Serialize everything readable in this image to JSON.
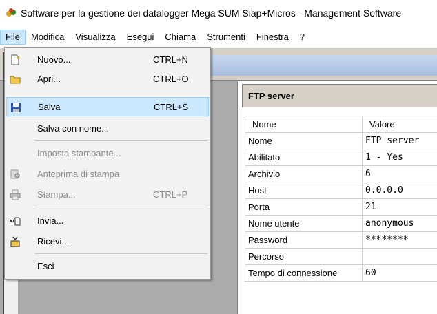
{
  "window": {
    "title": "Software per la gestione dei datalogger Mega SUM Siap+Micros - Management Software"
  },
  "menubar": {
    "items": [
      "File",
      "Modifica",
      "Visualizza",
      "Esegui",
      "Chiama",
      "Strumenti",
      "Finestra",
      "?"
    ],
    "active": "File"
  },
  "file_menu": {
    "items": [
      {
        "label": "Nuovo...",
        "shortcut": "CTRL+N",
        "icon": "new-document-icon",
        "disabled": false
      },
      {
        "label": "Apri...",
        "shortcut": "CTRL+O",
        "icon": "open-folder-icon",
        "disabled": false
      },
      {
        "label": "Salva",
        "shortcut": "CTRL+S",
        "icon": "save-disk-icon",
        "disabled": false,
        "selected": true
      },
      {
        "label": "Salva con nome...",
        "shortcut": "",
        "icon": "",
        "disabled": false
      },
      {
        "label": "Imposta stampante...",
        "shortcut": "",
        "icon": "",
        "disabled": true
      },
      {
        "label": "Anteprima di stampa",
        "shortcut": "",
        "icon": "print-preview-icon",
        "disabled": true
      },
      {
        "label": "Stampa...",
        "shortcut": "CTRL+P",
        "icon": "printer-icon",
        "disabled": true
      },
      {
        "label": "Invia...",
        "shortcut": "",
        "icon": "send-icon",
        "disabled": false
      },
      {
        "label": "Ricevi...",
        "shortcut": "",
        "icon": "receive-icon",
        "disabled": false
      },
      {
        "label": "Esci",
        "shortcut": "",
        "icon": "",
        "disabled": false
      }
    ]
  },
  "panel": {
    "header": "FTP server",
    "columns": [
      "Nome",
      "Valore"
    ],
    "rows": [
      {
        "key": "Nome",
        "value": "FTP server"
      },
      {
        "key": "Abilitato",
        "value": "1 - Yes"
      },
      {
        "key": "Archivio",
        "value": "6"
      },
      {
        "key": "Host",
        "value": "0.0.0.0"
      },
      {
        "key": "Porta",
        "value": "21"
      },
      {
        "key": "Nome utente",
        "value": "anonymous"
      },
      {
        "key": "Password",
        "value": "********"
      },
      {
        "key": "Percorso",
        "value": ""
      },
      {
        "key": "Tempo di connessione",
        "value": "60"
      }
    ]
  },
  "colors": {
    "selection": "#cce8ff",
    "selection_border": "#99d1ff",
    "workspace": "#ababab"
  }
}
